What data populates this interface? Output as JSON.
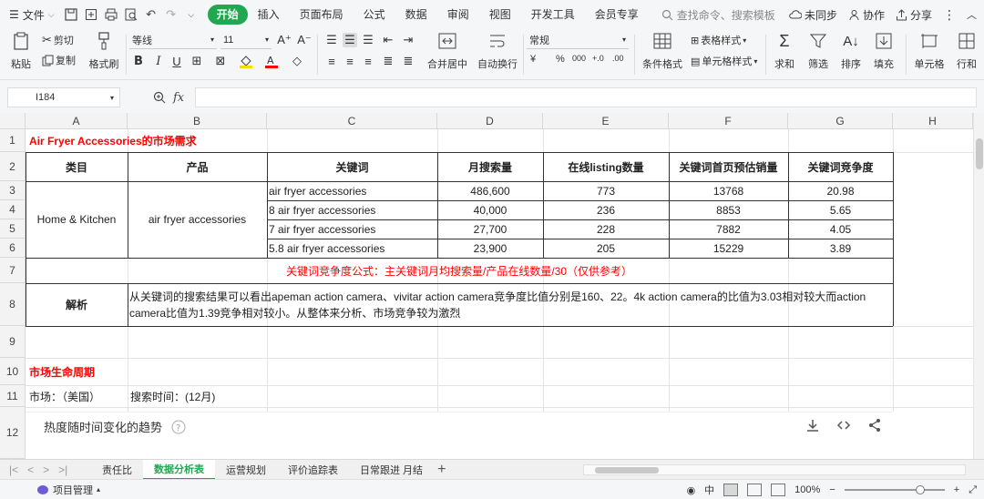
{
  "menubar": {
    "file": "文件",
    "tabs": [
      "开始",
      "插入",
      "页面布局",
      "公式",
      "数据",
      "审阅",
      "视图",
      "开发工具",
      "会员专享"
    ],
    "active_tab": 0,
    "search_placeholder": "查找命令、搜索模板",
    "sync": "未同步",
    "collab": "协作",
    "share": "分享"
  },
  "ribbon": {
    "paste": "粘贴",
    "cut": "剪切",
    "copy": "复制",
    "format_painter": "格式刷",
    "font_name": "等线",
    "font_size": "11",
    "merge_center": "合并居中",
    "wrap_text": "自动换行",
    "number_format": "常规",
    "conditional_format": "条件格式",
    "table_style": "表格样式",
    "cell_style": "单元格样式",
    "sum": "求和",
    "filter": "筛选",
    "sort": "排序",
    "fill": "填充",
    "cells": "单元格",
    "rows_cols": "行和",
    "currency": "¥",
    "percent": "%",
    "thousands": "000",
    "dec_inc": "+.0",
    "dec_dec": ".00"
  },
  "formula_bar": {
    "cell_ref": "I184",
    "fx": "fx",
    "content": ""
  },
  "sheet": {
    "columns": [
      "A",
      "B",
      "C",
      "D",
      "E",
      "F",
      "G",
      "H"
    ],
    "rows": [
      "1",
      "2",
      "3",
      "4",
      "5",
      "6",
      "7",
      "8",
      "9",
      "10",
      "11",
      "12"
    ],
    "title": "Air Fryer Accessories的市场需求",
    "headers": [
      "类目",
      "产品",
      "关键词",
      "月搜索量",
      "在线listing数量",
      "关键词首页预估销量",
      "关键词竞争度"
    ],
    "category": "Home & Kitchen",
    "product": "air fryer accessories",
    "data_rows": [
      [
        "air fryer accessories",
        "486,600",
        "773",
        "13768",
        "20.98"
      ],
      [
        "8 air fryer accessories",
        "40,000",
        "236",
        "8853",
        "5.65"
      ],
      [
        "7 air fryer accessories",
        "27,700",
        "228",
        "7882",
        "4.05"
      ],
      [
        "5.8 air fryer accessories",
        "23,900",
        "205",
        "15229",
        "3.89"
      ]
    ],
    "formula_note": "关键词竞争度公式：主关键词月均搜索量/产品在线数量/30（仅供参考）",
    "analysis_label": "解析",
    "analysis_text": "从关键词的搜索结果可以看出apeman action camera、vivitar action camera竞争度比值分别是160、22。4k action camera的比值为3.03相对较大而action camera比值为1.39竞争相对较小。从整体来分析、市场竞争较为激烈",
    "lifecycle_title": "市场生命周期",
    "market_label": "市场：（美国）",
    "search_time_label": "搜索时间：(12月)",
    "chart_panel_title": "热度随时间变化的趋势"
  },
  "sheet_tabs": {
    "tabs": [
      "责任比",
      "数据分析表",
      "运营规划",
      "评价追踪表",
      "日常跟进 月结"
    ],
    "active": 1
  },
  "status_bar": {
    "project": "项目管理",
    "zoom": "100%",
    "input_mode": "中"
  }
}
